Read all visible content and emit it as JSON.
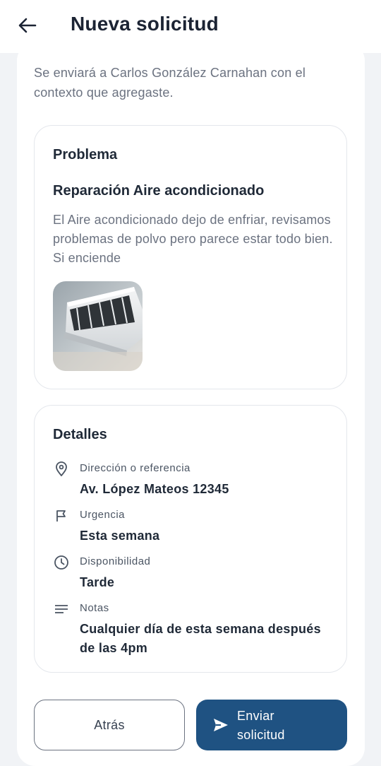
{
  "header": {
    "title": "Nueva solicitud",
    "back_icon": "arrow-left-icon"
  },
  "intro_text": "Se enviará a Carlos González Carnahan con el contexto que agregaste.",
  "problem_card": {
    "heading": "Problema",
    "title": "Reparación Aire acondicionado",
    "description": "El Aire acondicionado dejo de enfriar, revisamos problemas de polvo pero parece estar todo bien. Si enciende",
    "photo": "air-conditioner-photo"
  },
  "details_card": {
    "heading": "Detalles",
    "items": [
      {
        "icon": "location-pin-icon",
        "label": "Dirección o referencia",
        "value": "Av. López Mateos 12345"
      },
      {
        "icon": "flag-icon",
        "label": "Urgencia",
        "value": "Esta semana"
      },
      {
        "icon": "clock-icon",
        "label": "Disponibilidad",
        "value": "Tarde"
      },
      {
        "icon": "notes-icon",
        "label": "Notas",
        "value": "Cualquier día de esta semana después de las 4pm"
      }
    ]
  },
  "actions": {
    "back_label": "Atrás",
    "send_label": "Enviar solicitud",
    "send_icon": "send-icon",
    "primary_color": "#1f5282"
  }
}
